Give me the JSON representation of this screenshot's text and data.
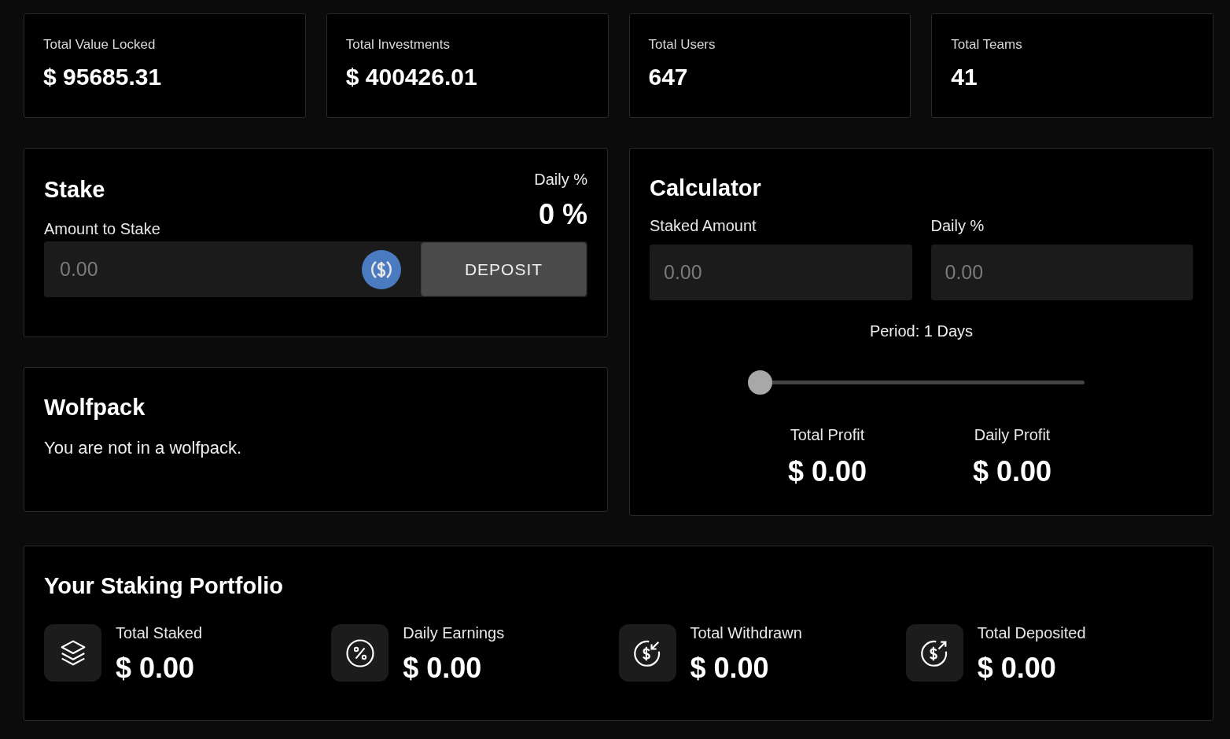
{
  "stats": [
    {
      "label": "Total Value Locked",
      "value": "$ 95685.31"
    },
    {
      "label": "Total Investments",
      "value": "$ 400426.01"
    },
    {
      "label": "Total Users",
      "value": "647"
    },
    {
      "label": "Total Teams",
      "value": "41"
    }
  ],
  "stake": {
    "title": "Stake",
    "daily_label": "Daily %",
    "daily_value": "0 %",
    "amount_label": "Amount to Stake",
    "placeholder": "0.00",
    "button": "DEPOSIT"
  },
  "wolfpack": {
    "title": "Wolfpack",
    "message": "You are not in a wolfpack."
  },
  "calculator": {
    "title": "Calculator",
    "fields": [
      {
        "label": "Staked Amount",
        "placeholder": "0.00"
      },
      {
        "label": "Daily %",
        "placeholder": "0.00"
      }
    ],
    "period": "Period: 1 Days",
    "level": 0,
    "results": [
      {
        "label": "Total Profit",
        "value": "$ 0.00"
      },
      {
        "label": "Daily Profit",
        "value": "$ 0.00"
      }
    ]
  },
  "portfolio": {
    "title": "Your Staking Portfolio",
    "items": [
      {
        "kind": "staked",
        "label": "Total Staked",
        "value": "$ 0.00"
      },
      {
        "kind": "earnings",
        "label": "Daily Earnings",
        "value": "$ 0.00"
      },
      {
        "kind": "withdrawn",
        "label": "Total Withdrawn",
        "value": "$ 0.00"
      },
      {
        "kind": "deposited",
        "label": "Total Deposited",
        "value": "$ 0.00"
      }
    ]
  }
}
